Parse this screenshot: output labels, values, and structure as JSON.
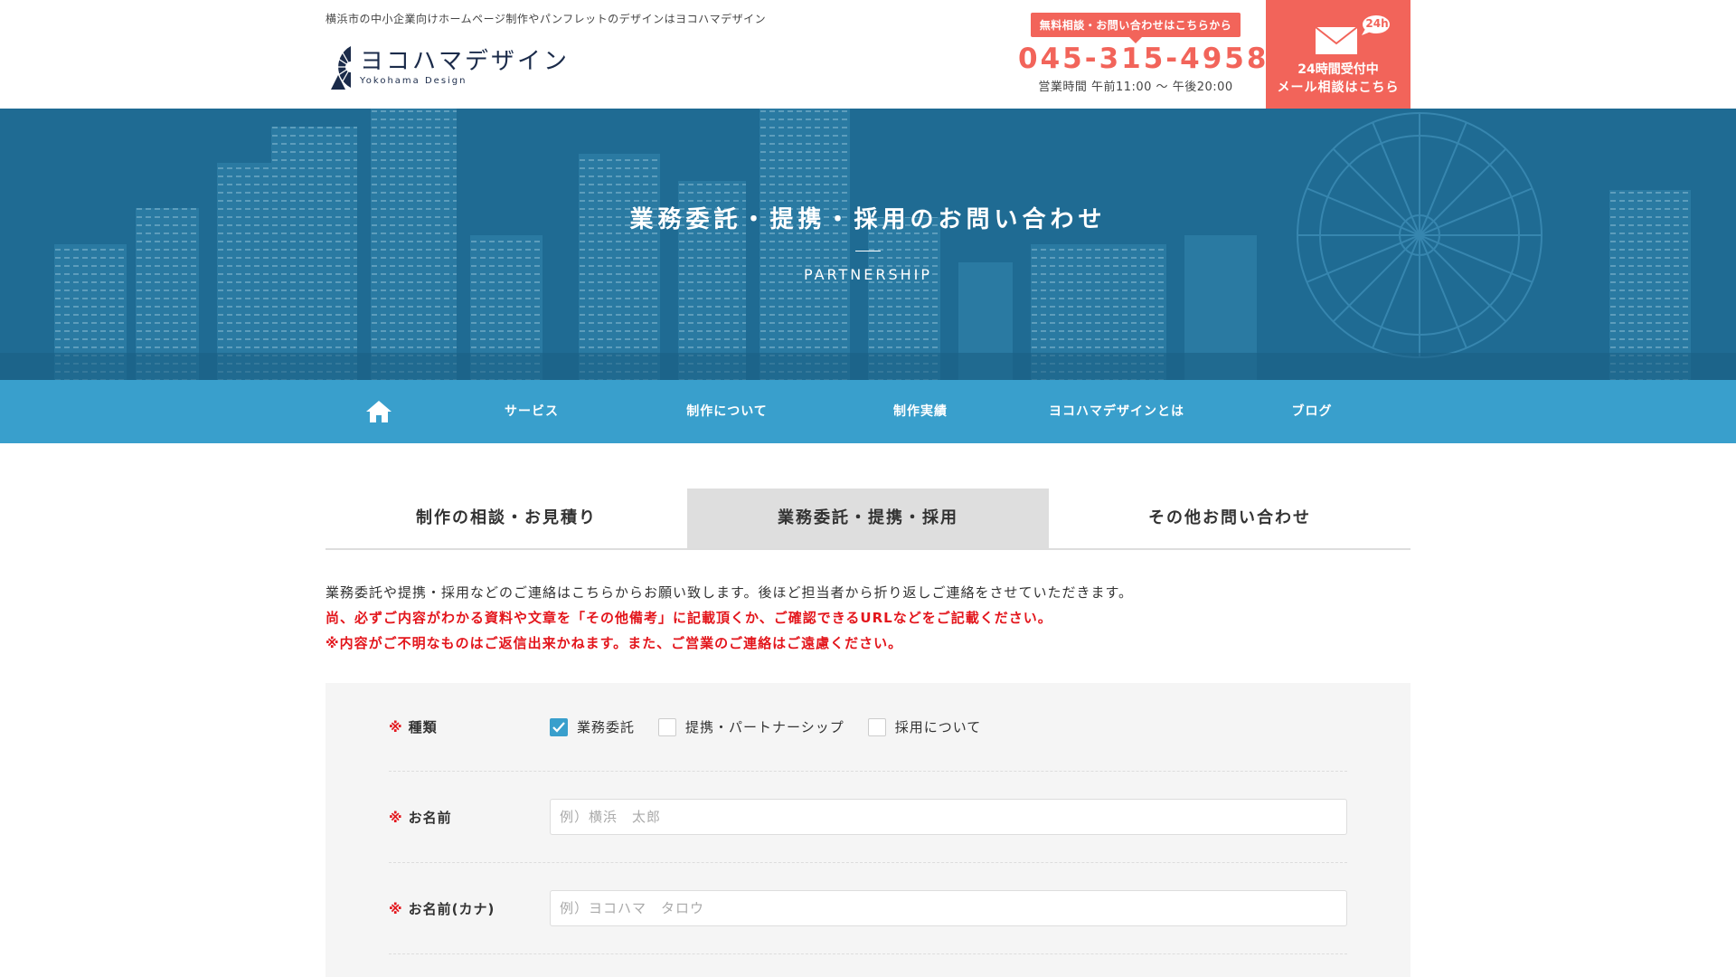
{
  "header": {
    "tagline": "横浜市の中小企業向けホームページ制作やパンフレットのデザインはヨコハマデザイン",
    "logo_name": "ヨコハマデザイン",
    "logo_sub": "Yokohama Design",
    "contact_badge": "無料相談・お問い合わせはこちらから",
    "phone": "045-315-4958",
    "hours": "営業時間 午前11:00 〜 午後20:00",
    "mail_badge": "24h",
    "mail_line1": "24時間受付中",
    "mail_line2": "メール相談はこちら"
  },
  "hero": {
    "title": "業務委託・提携・採用のお問い合わせ",
    "subtitle": "PARTNERSHIP"
  },
  "nav": {
    "items": [
      {
        "label": "サービス"
      },
      {
        "label": "制作について"
      },
      {
        "label": "制作実績"
      },
      {
        "label": "ヨコハマデザインとは"
      },
      {
        "label": "ブログ"
      }
    ]
  },
  "tabs": [
    {
      "label": "制作の相談・お見積り",
      "active": false
    },
    {
      "label": "業務委託・提携・採用",
      "active": true
    },
    {
      "label": "その他お問い合わせ",
      "active": false
    }
  ],
  "intro": {
    "line1": "業務委託や提携・採用などのご連絡はこちらからお願い致します。後ほど担当者から折り返しご連絡をさせていただきます。",
    "line2": "尚、必ずご内容がわかる資料や文章を「その他備考」に記載頂くか、ご確認できるURLなどをご記載ください。",
    "line3": "※内容がご不明なものはご返信出来かねます。また、ご営業のご連絡はご遠慮ください。"
  },
  "form": {
    "required_mark": "※",
    "type": {
      "label": "種類",
      "options": [
        {
          "label": "業務委託",
          "checked": true
        },
        {
          "label": "提携・パートナーシップ",
          "checked": false
        },
        {
          "label": "採用について",
          "checked": false
        }
      ]
    },
    "name": {
      "label": "お名前",
      "placeholder": "例）横浜　太郎",
      "value": ""
    },
    "kana": {
      "label": "お名前(カナ)",
      "placeholder": "例）ヨコハマ　タロウ",
      "value": ""
    }
  },
  "colors": {
    "accent": "#f2645a",
    "nav": "#399fcc",
    "hero": "#1f6b93",
    "required": "#e3161c"
  },
  "icons": {
    "home": "home-icon",
    "mail": "mail-icon",
    "check": "check-icon",
    "logo": "ferris-wheel-icon"
  }
}
